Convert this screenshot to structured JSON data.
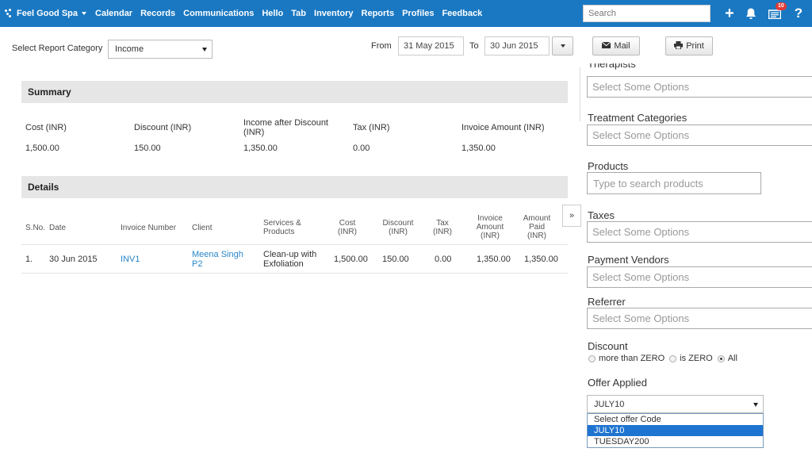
{
  "nav": {
    "brand": "Feel Good Spa",
    "items": [
      "Calendar",
      "Records",
      "Communications",
      "Hello",
      "Tab",
      "Inventory",
      "Reports",
      "Profiles",
      "Feedback"
    ],
    "search_placeholder": "Search",
    "add_icon": "plus-icon",
    "bell_icon": "bell-icon",
    "tasks_icon": "tasks-icon",
    "tasks_badge": "10",
    "help_icon": "help-icon",
    "add_glyph": "+",
    "help_glyph": "?",
    "color": "#1a78c2"
  },
  "toolbar": {
    "category_label": "Select Report Category",
    "category_value": "Income",
    "from_label": "From",
    "from_date": "31 May 2015",
    "to_label": "To",
    "to_date": "30 Jun 2015",
    "mail_label": "Mail",
    "print_label": "Print"
  },
  "summary": {
    "title": "Summary",
    "headers": [
      "Cost (INR)",
      "Discount (INR)",
      "Income after Discount (INR)",
      "Tax (INR)",
      "Invoice Amount (INR)"
    ],
    "values": [
      "1,500.00",
      "150.00",
      "1,350.00",
      "0.00",
      "1,350.00"
    ]
  },
  "details": {
    "title": "Details",
    "headers": [
      "S.No.",
      "Date",
      "Invoice Number",
      "Client",
      "Services & Products",
      "Cost (INR)",
      "Discount (INR)",
      "Tax (INR)",
      "Invoice Amount (INR)",
      "Amount Paid (INR)"
    ],
    "rows": [
      {
        "sno": "1.",
        "date": "30 Jun 2015",
        "invoice": "INV1",
        "client": "Meena Singh P2",
        "services": "Clean-up with Exfoliation",
        "cost": "1,500.00",
        "discount": "150.00",
        "tax": "0.00",
        "invoice_amount": "1,350.00",
        "amount_paid": "1,350.00"
      }
    ]
  },
  "filters": {
    "collapse_glyph": "»",
    "therapists_label": "Therapists",
    "treatment_label": "Treatment Categories",
    "products_label": "Products",
    "products_placeholder": "Type to search products",
    "taxes_label": "Taxes",
    "vendors_label": "Payment Vendors",
    "referrer_label": "Referrer",
    "multiselect_placeholder": "Select Some Options",
    "discount_label": "Discount",
    "discount_options": [
      "more than ZERO",
      "is ZERO",
      "All"
    ],
    "discount_selected": "All",
    "offer_label": "Offer Applied",
    "offer_value": "JULY10",
    "offer_options": [
      "Select offer Code",
      "JULY10",
      "TUESDAY200"
    ]
  }
}
